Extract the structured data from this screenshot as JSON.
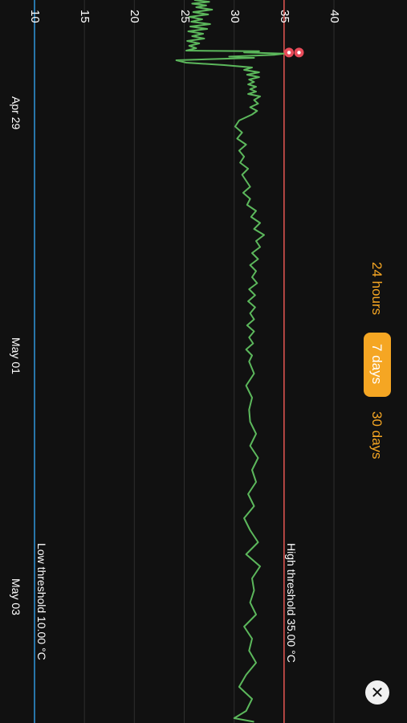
{
  "range_tabs": [
    {
      "label": "24 hours",
      "selected": false
    },
    {
      "label": "7 days",
      "selected": true
    },
    {
      "label": "30 days",
      "selected": false
    }
  ],
  "close_icon": "close-icon",
  "colors": {
    "background": "#111111",
    "series": "#5cb85c",
    "high_threshold": "#d9534f",
    "low_threshold": "#2e8fd0",
    "accent": "#f5a623",
    "marker": "#e84c5a"
  },
  "chart_data": {
    "type": "line",
    "title": "",
    "xlabel": "",
    "ylabel": "",
    "ylim": [
      10,
      40
    ],
    "y_ticks": [
      "10",
      "15",
      "20",
      "25",
      "30",
      "35",
      "40"
    ],
    "x_ticks": [
      "Apr 29",
      "May 01",
      "May 03"
    ],
    "x_tick_days": [
      1,
      3,
      5
    ],
    "grid": true,
    "thresholds": [
      {
        "label": "High threshold 35.00 °C",
        "value": 35
      },
      {
        "label": "Low threshold 10.00 °C",
        "value": 10
      }
    ],
    "marker_points": [
      {
        "day": 0.436,
        "value": 35.5
      },
      {
        "day": 0.436,
        "value": 36.5
      }
    ],
    "series": [
      {
        "x": [
          0.0,
          0.015,
          0.03,
          0.045,
          0.06,
          0.08,
          0.1,
          0.12,
          0.14,
          0.16,
          0.18,
          0.2,
          0.22,
          0.24,
          0.26,
          0.28,
          0.3,
          0.32,
          0.34,
          0.36,
          0.38,
          0.4,
          0.42,
          0.425,
          0.435,
          0.445,
          0.455,
          0.47,
          0.48,
          0.5,
          0.52,
          0.54,
          0.56,
          0.58,
          0.6,
          0.62,
          0.64,
          0.66,
          0.68,
          0.7,
          0.72,
          0.74,
          0.76,
          0.78,
          0.8,
          0.83,
          0.86,
          0.89,
          0.92,
          0.95,
          1.0,
          1.05,
          1.1,
          1.15,
          1.2,
          1.25,
          1.3,
          1.35,
          1.4,
          1.45,
          1.5,
          1.55,
          1.6,
          1.65,
          1.7,
          1.75,
          1.8,
          1.85,
          1.9,
          1.95,
          2.0,
          2.05,
          2.1,
          2.15,
          2.2,
          2.25,
          2.3,
          2.35,
          2.4,
          2.45,
          2.5,
          2.55,
          2.6,
          2.65,
          2.7,
          2.75,
          2.8,
          2.85,
          2.9,
          2.95,
          3.0,
          3.1,
          3.2,
          3.3,
          3.4,
          3.5,
          3.6,
          3.7,
          3.8,
          3.9,
          4.0,
          4.1,
          4.2,
          4.3,
          4.4,
          4.5,
          4.6,
          4.7,
          4.8,
          4.9,
          5.0,
          5.1,
          5.2,
          5.3,
          5.4,
          5.5,
          5.6,
          5.7,
          5.8,
          5.9,
          5.96,
          5.99
        ],
        "values": [
          26.0,
          27.5,
          25.8,
          27.2,
          26.2,
          27.8,
          25.9,
          27.4,
          25.5,
          26.8,
          25.7,
          27.6,
          25.6,
          27.3,
          25.4,
          26.9,
          25.8,
          27.0,
          25.3,
          26.5,
          25.5,
          26.2,
          25.2,
          32.5,
          31.0,
          35.0,
          34.0,
          29.5,
          32.0,
          24.2,
          25.2,
          29.0,
          31.8,
          31.0,
          32.5,
          31.3,
          32.5,
          31.5,
          32.0,
          31.4,
          32.2,
          31.6,
          32.2,
          31.4,
          32.6,
          32.0,
          32.4,
          31.6,
          32.3,
          31.8,
          30.5,
          30.1,
          30.8,
          30.3,
          31.2,
          30.5,
          31.0,
          30.6,
          31.4,
          30.8,
          31.2,
          31.6,
          30.9,
          31.6,
          31.3,
          32.2,
          31.7,
          32.6,
          32.0,
          33.0,
          32.2,
          32.6,
          31.8,
          32.4,
          31.6,
          32.2,
          31.8,
          32.3,
          31.5,
          32.1,
          31.4,
          32.1,
          31.6,
          32.0,
          31.3,
          32.0,
          31.5,
          31.9,
          31.2,
          31.8,
          31.5,
          32.0,
          31.2,
          31.8,
          31.5,
          31.6,
          32.2,
          31.6,
          32.4,
          31.8,
          32.2,
          31.4,
          32.0,
          31.0,
          31.6,
          32.4,
          31.2,
          32.6,
          31.8,
          32.0,
          31.6,
          32.2,
          31.0,
          31.8,
          31.5,
          32.2,
          31.2,
          30.5,
          31.8,
          31.2,
          30.0,
          32.0
        ]
      }
    ]
  }
}
